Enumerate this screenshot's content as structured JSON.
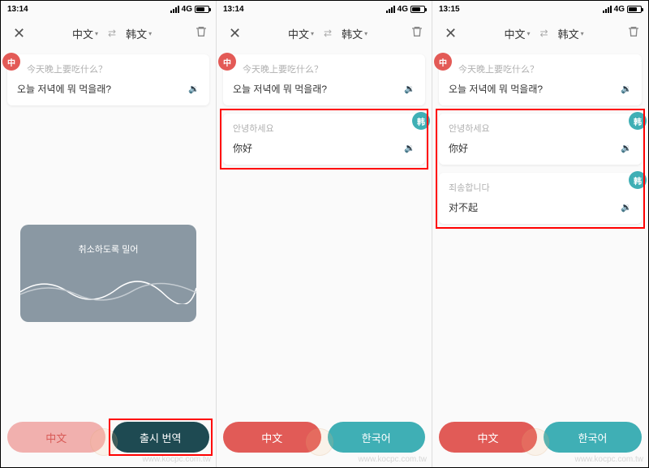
{
  "screens": [
    {
      "time": "13:14",
      "network": "4G",
      "lang_from": "中文",
      "lang_to": "韩文",
      "cards": [
        {
          "side": "left",
          "badge": "中",
          "src": "今天晚上要吃什么？",
          "tgt": "오늘 저녁에 뭐 먹을래?"
        }
      ],
      "voice_label": "취소하도록 밀어",
      "btn_left": "中文",
      "btn_right": "출시 번역",
      "btn_left_style": "light",
      "btn_right_style": "dark",
      "highlight_right_btn": true
    },
    {
      "time": "13:14",
      "network": "4G",
      "lang_from": "中文",
      "lang_to": "韩文",
      "cards": [
        {
          "side": "left",
          "badge": "中",
          "src": "今天晚上要吃什么？",
          "tgt": "오늘 저녁에 뭐 먹을래?"
        },
        {
          "side": "right",
          "badge": "韩",
          "src": "안녕하세요",
          "tgt": "你好"
        }
      ],
      "btn_left": "中文",
      "btn_right": "한국어",
      "btn_left_style": "red",
      "btn_right_style": "teal",
      "highlight_cards": [
        1
      ]
    },
    {
      "time": "13:15",
      "network": "4G",
      "lang_from": "中文",
      "lang_to": "韩文",
      "cards": [
        {
          "side": "left",
          "badge": "中",
          "src": "今天晚上要吃什么？",
          "tgt": "오늘 저녁에 뭐 먹을래?"
        },
        {
          "side": "right",
          "badge": "韩",
          "src": "안녕하세요",
          "tgt": "你好"
        },
        {
          "side": "right",
          "badge": "韩",
          "src": "죄송합니다",
          "tgt": "对不起"
        }
      ],
      "btn_left": "中文",
      "btn_right": "한국어",
      "btn_left_style": "red",
      "btn_right_style": "teal",
      "highlight_cards": [
        1,
        2
      ]
    }
  ],
  "watermark": "www.kocpc.com.tw"
}
